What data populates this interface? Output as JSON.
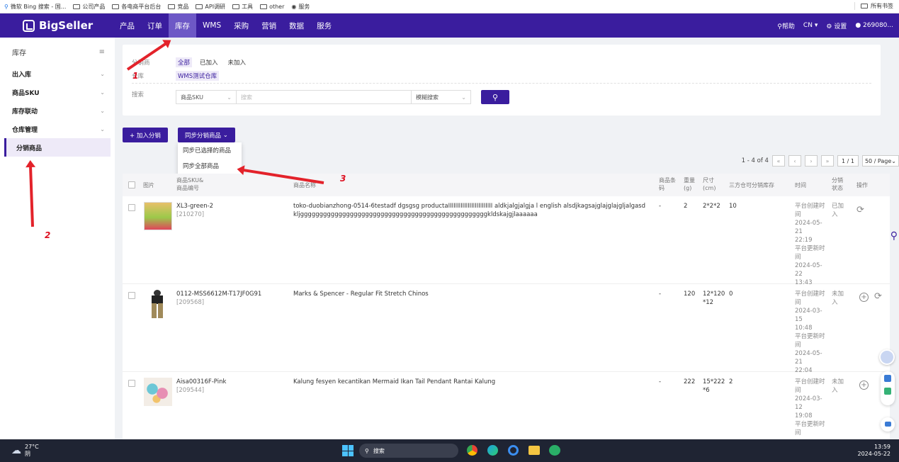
{
  "bookmarks": [
    {
      "label": "微软 Bing 搜索 - 国...",
      "icon": "search-icon"
    },
    {
      "label": "公司产品",
      "icon": "folder-icon"
    },
    {
      "label": "各电商平台后台",
      "icon": "folder-icon"
    },
    {
      "label": "竞品",
      "icon": "folder-icon"
    },
    {
      "label": "API调研",
      "icon": "folder-icon"
    },
    {
      "label": "工具",
      "icon": "folder-icon"
    },
    {
      "label": "other",
      "icon": "folder-icon"
    },
    {
      "label": "服务",
      "icon": "globe-icon"
    }
  ],
  "bookmarks_right": "所有书签",
  "topnav": {
    "brand": "BigSeller",
    "items": [
      "产品",
      "订单",
      "库存",
      "WMS",
      "采购",
      "营销",
      "数据",
      "服务"
    ],
    "active": "库存",
    "help": "帮助",
    "lang": "CN",
    "settings": "设置",
    "user": "269080..."
  },
  "sidebar": {
    "title": "库存",
    "items": [
      {
        "label": "出入库"
      },
      {
        "label": "商品SKU"
      },
      {
        "label": "库存联动"
      },
      {
        "label": "仓库管理"
      },
      {
        "label": "分销商品"
      }
    ]
  },
  "filters": {
    "distribution_label": "分销商",
    "distribution_options": [
      "全部",
      "已加入",
      "未加入"
    ],
    "warehouse_label": "仓库",
    "warehouse_value": "WMS测试仓库",
    "search_label": "搜索",
    "search_field": "商品SKU",
    "search_placeholder": "搜索",
    "search_mode": "模糊搜索"
  },
  "toolbar": {
    "add_label": "+ 加入分销",
    "sync_label": "同步分销商品",
    "dropdown_items": [
      "同步已选择的商品",
      "同步全部商品"
    ]
  },
  "pager": {
    "range": "1 - 4 of 4",
    "page": "1 / 1",
    "page_size": "50 / Page"
  },
  "table": {
    "headers": {
      "image": "图片",
      "sku": "商品SKU&\n商品编号",
      "name": "商品名称",
      "barcode": "商品条码",
      "weight": "重量(g)",
      "size": "尺寸(cm)",
      "stock": "三方仓可分销库存",
      "time": "时间",
      "status": "分销状态",
      "action": "操作"
    },
    "rows": [
      {
        "sku": "XL3-green-2",
        "code": "[210270]",
        "name": "toko-duobianzhong-0514-6testadf dgsgsg productaIIIIIIIIIIIIIIIIIIIIIIIII aldkjalgjalgja l english alsdjkagsajglajglajgljalgasdkljgggggggggggggggggggggggggggggggggggggggggggggggggkldskajgjlaaaaaa",
        "barcode": "-",
        "weight": "2",
        "size": "2*2*2",
        "stock": "10",
        "time": "平台创建时间\n2024-05-21\n22:19\n平台更新时间\n2024-05-22\n13:43",
        "status": "已加入"
      },
      {
        "sku": "0112-MSS6612M-T17JF0G91",
        "code": "[209568]",
        "name": "Marks & Spencer - Regular Fit Stretch Chinos",
        "barcode": "-",
        "weight": "120",
        "size": "12*120\n*12",
        "stock": "0",
        "time": "平台创建时间\n2024-03-15\n10:48\n平台更新时间\n2024-05-21\n22:04",
        "status": "未加入"
      },
      {
        "sku": "Aisa00316F-Pink",
        "code": "[209544]",
        "name": "Kalung fesyen kecantikan Mermaid Ikan Tail Pendant Rantai Kalung",
        "barcode": "-",
        "weight": "222",
        "size": "15*222\n*6",
        "stock": "2",
        "time": "平台创建时间\n2024-03-12\n19:08\n平台更新时间",
        "status": "未加入"
      }
    ]
  },
  "annotations": [
    "1",
    "2",
    "3"
  ],
  "taskbar": {
    "weather_temp": "27°C",
    "weather_desc": "阴",
    "search": "搜索",
    "time": "13:59",
    "date": "2024-05-22"
  }
}
